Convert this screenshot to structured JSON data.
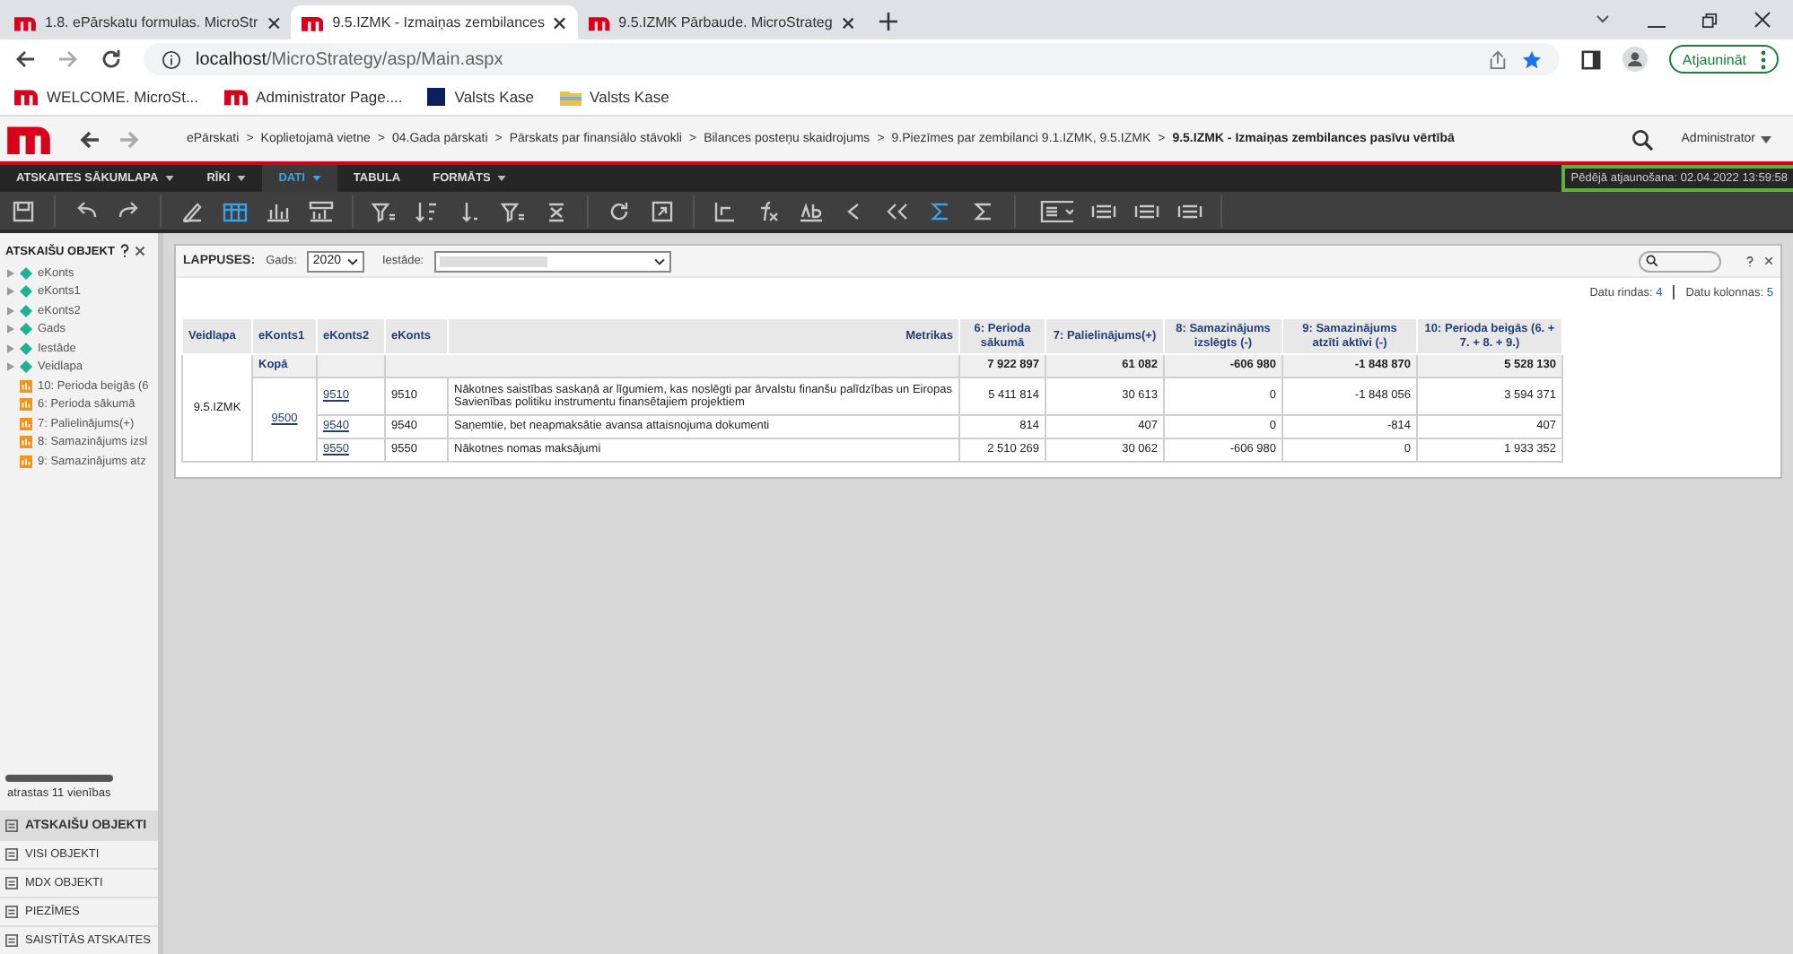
{
  "browser": {
    "tabs": [
      {
        "title": "1.8. ePārskatu formulas. MicroStr",
        "selected": false
      },
      {
        "title": "9.5.IZMK - Izmaiņas zembilances",
        "selected": true
      },
      {
        "title": "9.5.IZMK Pārbaude. MicroStrateg",
        "selected": false
      }
    ],
    "address": {
      "host": "localhost",
      "path": "/MicroStrategy/asp/Main.aspx"
    },
    "update_button": "Atjaunināt",
    "bookmarks": [
      {
        "label": "WELCOME. MicroSt...",
        "kind": "logo"
      },
      {
        "label": "Administrator Page....",
        "kind": "logo"
      },
      {
        "label": "Valsts Kase",
        "kind": "square"
      },
      {
        "label": "Valsts Kase",
        "kind": "folder"
      }
    ]
  },
  "header": {
    "breadcrumbs": [
      "ePārskati",
      "Koplietojamā vietne",
      "04.Gada pārskati",
      "Pārskats par finansiālo stāvokli",
      "Bilances posteņu skaidrojums",
      "9.Piezīmes par zembilanci 9.1.IZMK, 9.5.IZMK",
      "9.5.IZMK - Izmaiņas zembilances pasīvu vērtībā"
    ],
    "separator": ">",
    "user": "Administrator"
  },
  "menu": [
    {
      "label": "ATSKAITES SĀKUMLAPA",
      "dropdown": true,
      "selected": false
    },
    {
      "label": "RĪKI",
      "dropdown": true,
      "selected": false
    },
    {
      "label": "DATI",
      "dropdown": true,
      "selected": true
    },
    {
      "label": "TABULA",
      "dropdown": false,
      "selected": false
    },
    {
      "label": "FORMĀTS",
      "dropdown": true,
      "selected": false
    }
  ],
  "last_refresh": {
    "text": "Pēdējā atjaunošana: 02.04.2022 13:59:58",
    "highlighted": true
  },
  "toolbar": [
    {
      "kind": "save",
      "selected": false
    },
    {
      "kind": "sep"
    },
    {
      "kind": "undo",
      "selected": false
    },
    {
      "kind": "redo",
      "selected": false
    },
    {
      "kind": "sep"
    },
    {
      "kind": "pen",
      "selected": false
    },
    {
      "kind": "grid",
      "selected": true
    },
    {
      "kind": "chart",
      "selected": false
    },
    {
      "kind": "gridchart",
      "selected": false
    },
    {
      "kind": "sep"
    },
    {
      "kind": "filter",
      "selected": false
    },
    {
      "kind": "sort",
      "selected": false
    },
    {
      "kind": "sortdown",
      "selected": false
    },
    {
      "kind": "filter",
      "selected": false
    },
    {
      "kind": "clear",
      "selected": false
    },
    {
      "kind": "sep"
    },
    {
      "kind": "refresh",
      "selected": false
    },
    {
      "kind": "export",
      "selected": false
    },
    {
      "kind": "sep"
    },
    {
      "kind": "pivot",
      "selected": false
    },
    {
      "kind": "fx",
      "selected": false
    },
    {
      "kind": "ab",
      "selected": false
    },
    {
      "kind": "left",
      "selected": false
    },
    {
      "kind": "swap",
      "selected": false
    },
    {
      "kind": "sigma",
      "selected": true
    },
    {
      "kind": "sigma",
      "selected": false
    },
    {
      "kind": "sep"
    },
    {
      "kind": "groupdrop",
      "selected": false
    },
    {
      "kind": "group",
      "selected": false
    },
    {
      "kind": "group",
      "selected": false
    },
    {
      "kind": "group",
      "selected": false
    },
    {
      "kind": "sep"
    }
  ],
  "sidebar": {
    "title": "ATSKAIŠU OBJEKT",
    "items": [
      {
        "label": "eKonts",
        "kind": "attribute"
      },
      {
        "label": "eKonts1",
        "kind": "attribute"
      },
      {
        "label": "eKonts2",
        "kind": "attribute"
      },
      {
        "label": "Gads",
        "kind": "attribute"
      },
      {
        "label": "Iestāde",
        "kind": "attribute"
      },
      {
        "label": "Veidlapa",
        "kind": "attribute"
      },
      {
        "label": "10: Perioda beigās (6",
        "kind": "metric"
      },
      {
        "label": "6: Perioda sākumā",
        "kind": "metric"
      },
      {
        "label": "7: Palielinājums(+)",
        "kind": "metric"
      },
      {
        "label": "8: Samazinājums izsl",
        "kind": "metric"
      },
      {
        "label": "9: Samazinājums atz",
        "kind": "metric"
      }
    ],
    "found": "atrastas 11 vienības",
    "sections": [
      {
        "label": "ATSKAIŠU OBJEKTI",
        "selected": true
      },
      {
        "label": "VISI OBJEKTI",
        "selected": false
      },
      {
        "label": "MDX OBJEKTI",
        "selected": false
      },
      {
        "label": "PIEZĪMES",
        "selected": false
      },
      {
        "label": "SAISTĪTĀS ATSKAITES",
        "selected": false
      }
    ]
  },
  "page_by": {
    "label": "LAPPUSES:",
    "fields": [
      {
        "label": "Gads:",
        "value": "2020"
      },
      {
        "label": "Iestāde:"
      }
    ]
  },
  "counts": [
    {
      "label": "Datu rindas:",
      "value": "4"
    },
    {
      "label": "Datu kolonnas:",
      "value": "5"
    }
  ],
  "table": {
    "columns": [
      "Veidlapa",
      "eKonts1",
      "eKonts2",
      "eKonts",
      "Metrikas",
      "6: Perioda sākumā",
      "7: Palielinājums(+)",
      "8: Samazinājums izslēgts (-)",
      "9: Samazinājums atzīti aktīvi (-)",
      "10: Perioda beigās (6. + 7. + 8. + 9.)"
    ],
    "form": "9.5.IZMK",
    "group": "9500",
    "total": {
      "label": "Kopā",
      "values": [
        "7 922 897",
        "61 082",
        "-606 980",
        "-1 848 870",
        "5 528 130"
      ]
    },
    "rows": [
      {
        "konts2": "9510",
        "konts": "9510",
        "name": "Nākotnes saistības saskaņā ar līgumiem, kas noslēgti par ārvalstu finanšu palīdzības un Eiropas Savienības politiku instrumentu finansētajiem projektiem",
        "values": [
          "5 411 814",
          "30 613",
          "0",
          "-1 848 056",
          "3 594 371"
        ]
      },
      {
        "konts2": "9540",
        "konts": "9540",
        "name": "Saņemtie, bet neapmaksātie avansa attaisnojuma dokumenti",
        "values": [
          "814",
          "407",
          "0",
          "-814",
          "407"
        ]
      },
      {
        "konts2": "9550",
        "konts": "9550",
        "name": "Nākotnes nomas maksājumi",
        "values": [
          "2 510 269",
          "30 062",
          "-606 980",
          "0",
          "1 933 352"
        ]
      }
    ]
  }
}
